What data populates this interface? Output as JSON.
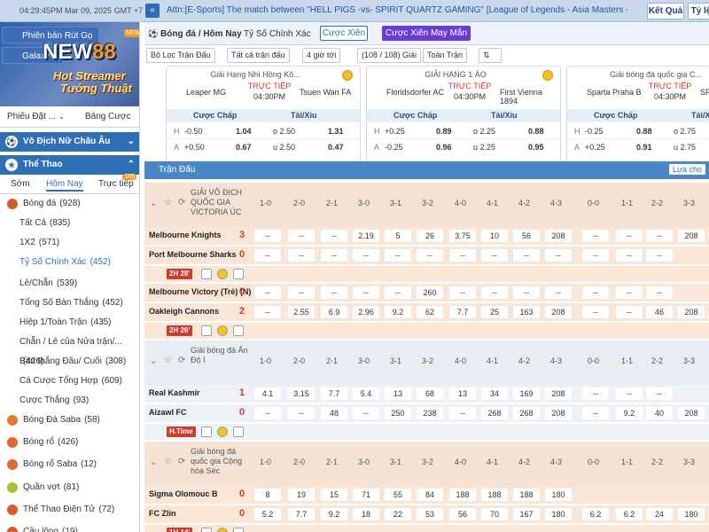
{
  "topbar": {
    "datetime": "04:29:45PM Mar 09, 2025 GMT +7",
    "announcement": "Attn:[E-Sports] The match between \"HELL PIGS -vs- SPIRIT QUARTZ GAMING\" [League of Legends - Asia Masters - 9/3] has been",
    "btn_result": "Kết Quả",
    "btn_rate": "Tỷ lệ"
  },
  "sidebar": {
    "promo_btn1": "Phiên bản Rút Gọ",
    "promo_btn2": "Galaxy",
    "logo": "NEW",
    "logo_num": "88",
    "new_badge": "NEW",
    "hot_line1": "Hot Streamer",
    "hot_line2": "Tưởng Thuật",
    "tab_ticket": "Phiếu Đặt ...",
    "tab_board": "Bảng Cược",
    "sec_euro": "Vô Địch Nữ Châu Âu",
    "sec_sports": "Thể Thao",
    "sub_early": "Sớm",
    "sub_today": "Hôm Nay",
    "sub_live": "Trực tiếp",
    "sub_live_badge": "165",
    "items": [
      {
        "label": "Bóng đá",
        "count": "(928)"
      },
      {
        "label": "Tất Cả",
        "count": "(835)"
      },
      {
        "label": "1X2",
        "count": "(571)"
      },
      {
        "label": "Tỷ Số Chính Xác",
        "count": "(452)"
      },
      {
        "label": "Lẻ/Chẵn",
        "count": "(539)"
      },
      {
        "label": "Tổng Số Bàn Thắng",
        "count": "(452)"
      },
      {
        "label": "Hiệp 1/Toàn Trận",
        "count": "(435)"
      },
      {
        "label": "Chẵn / Lẻ của Nửa trận/...",
        "count": "(426)"
      },
      {
        "label": "Bàn thắng Đầu/ Cuối",
        "count": "(308)"
      },
      {
        "label": "Cá Cược Tổng Hợp",
        "count": "(609)"
      },
      {
        "label": "Cược Thắng",
        "count": "(93)"
      },
      {
        "label": "Bóng Đá Saba",
        "count": "(58)"
      },
      {
        "label": "Bóng rổ",
        "count": "(426)"
      },
      {
        "label": "Bóng rổ Saba",
        "count": "(12)"
      },
      {
        "label": "Quần vợt",
        "count": "(81)"
      },
      {
        "label": "Thể Thao Điện Tử",
        "count": "(72)"
      },
      {
        "label": "Cầu lông",
        "count": "(19)"
      }
    ]
  },
  "nav": {
    "title": "Bóng đá / Hôm Nay",
    "exact": "Tỷ Số Chính Xác",
    "parlay": "Cược Xiên",
    "lucky": "Cược Xiên May Mắn",
    "f_league": "Bộ Lọc Trận Đấu",
    "f_all": "Tất cả trận đấu",
    "f_hours": "4 giờ tới",
    "f_count": "(108 / 108) Giải",
    "f_full": "Toàn Trận"
  },
  "highlights": [
    {
      "league": "Giải Hạng Nhì Hồng Kô...",
      "home": "Leaper MG",
      "away": "Tsuen Wan FA",
      "live": "TRỰC TIẾP",
      "time": "04:30PM",
      "h_hcap": "-0.50",
      "h_hcap_odd": "1.04",
      "a_hcap": "+0.50",
      "a_hcap_odd": "0.67",
      "h_ou": "o 2.50",
      "h_ou_odd": "1.31",
      "a_ou": "u 2.50",
      "a_ou_odd": "0.47"
    },
    {
      "league": "GIẢI HẠNG 1 ÁO",
      "home": "Floridsdorfer AC",
      "away": "First Vienna 1894",
      "live": "TRỰC TIẾP",
      "time": "04:30PM",
      "h_hcap": "+0.25",
      "h_hcap_odd": "0.89",
      "a_hcap": "-0.25",
      "a_hcap_odd": "0.96",
      "h_ou": "o 2.25",
      "h_ou_odd": "0.88",
      "a_ou": "u 2.25",
      "a_ou_odd": "0.95"
    },
    {
      "league": "Giải bóng đá quốc gia C...",
      "home": "Sparta Praha B",
      "away": "SFC",
      "live": "TRỰC TIẾP",
      "time": "04:30PM",
      "h_hcap": "-0.25",
      "h_hcap_odd": "0.88",
      "a_hcap": "+0.25",
      "a_hcap_odd": "0.91",
      "h_ou": "o 2.75",
      "h_ou_odd": "",
      "a_ou": "u 2.75",
      "a_ou_odd": ""
    }
  ],
  "hl_labels": {
    "home_code": "H",
    "away_code": "A",
    "hcap": "Cược Chấp",
    "ou": "Tài/Xỉu"
  },
  "table": {
    "header": "Trận Đấu",
    "choose": "Lựa chọ",
    "scores": [
      "1-0",
      "2-0",
      "2-1",
      "3-0",
      "3-1",
      "3-2",
      "4-0",
      "4-1",
      "4-2",
      "4-3",
      "0-0",
      "1-1",
      "2-2",
      "3-3"
    ],
    "leagues": [
      {
        "name": "GIẢI VÔ ĐỊCH QUỐC GIA VICTORIA ÚC",
        "matches": [
          {
            "home": "Melbourne Knights",
            "away": "Port Melbourne Sharks",
            "hs": "3",
            "as": "0",
            "status": "2H 28'",
            "home_odds": [
              "--",
              "--",
              "--",
              "2.19",
              "5",
              "26",
              "3.75",
              "10",
              "56",
              "208",
              "--",
              "--",
              "--",
              "208"
            ],
            "away_odds": [
              "--",
              "--",
              "--",
              "--",
              "--",
              "--",
              "--",
              "--",
              "--",
              "--",
              "--",
              "--",
              "--",
              ""
            ]
          },
          {
            "home": "Melbourne Victory (Trẻ) (N)",
            "away": "Oakleigh Cannons",
            "hs": "0",
            "as": "2",
            "status": "2H 26'",
            "home_odds": [
              "--",
              "--",
              "--",
              "--",
              "--",
              "260",
              "--",
              "--",
              "--",
              "--",
              "--",
              "--",
              "--",
              ""
            ],
            "away_odds": [
              "--",
              "2.55",
              "6.9",
              "2.96",
              "9.2",
              "62",
              "7.7",
              "25",
              "163",
              "208",
              "--",
              "--",
              "46",
              "208"
            ]
          }
        ]
      },
      {
        "name": "Giải bóng đá Ấn Độ I",
        "matches": [
          {
            "home": "Real Kashmir",
            "away": "Aizawl FC",
            "hs": "1",
            "as": "0",
            "status": "H.Time",
            "home_odds": [
              "4.1",
              "3.15",
              "7.7",
              "5.4",
              "13",
              "68",
              "13",
              "34",
              "169",
              "208",
              "--",
              "--",
              "--",
              ""
            ],
            "away_odds": [
              "--",
              "--",
              "48",
              "--",
              "250",
              "238",
              "--",
              "268",
              "268",
              "208",
              "--",
              "9.2",
              "40",
              "208"
            ]
          }
        ]
      },
      {
        "name": "Giải bóng đá quốc gia Cộng hòa Séc",
        "matches": [
          {
            "home": "Sigma Olomouc B",
            "away": "FC Zlin",
            "hs": "0",
            "as": "0",
            "status": "1H 14'",
            "home_odds": [
              "8",
              "19",
              "15",
              "71",
              "55",
              "84",
              "188",
              "188",
              "188",
              "180",
              "",
              "",
              "",
              ""
            ],
            "away_odds": [
              "5.2",
              "7.7",
              "9.2",
              "18",
              "22",
              "53",
              "56",
              "70",
              "167",
              "180",
              "6.2",
              "6.2",
              "24",
              "180"
            ]
          }
        ]
      }
    ]
  }
}
